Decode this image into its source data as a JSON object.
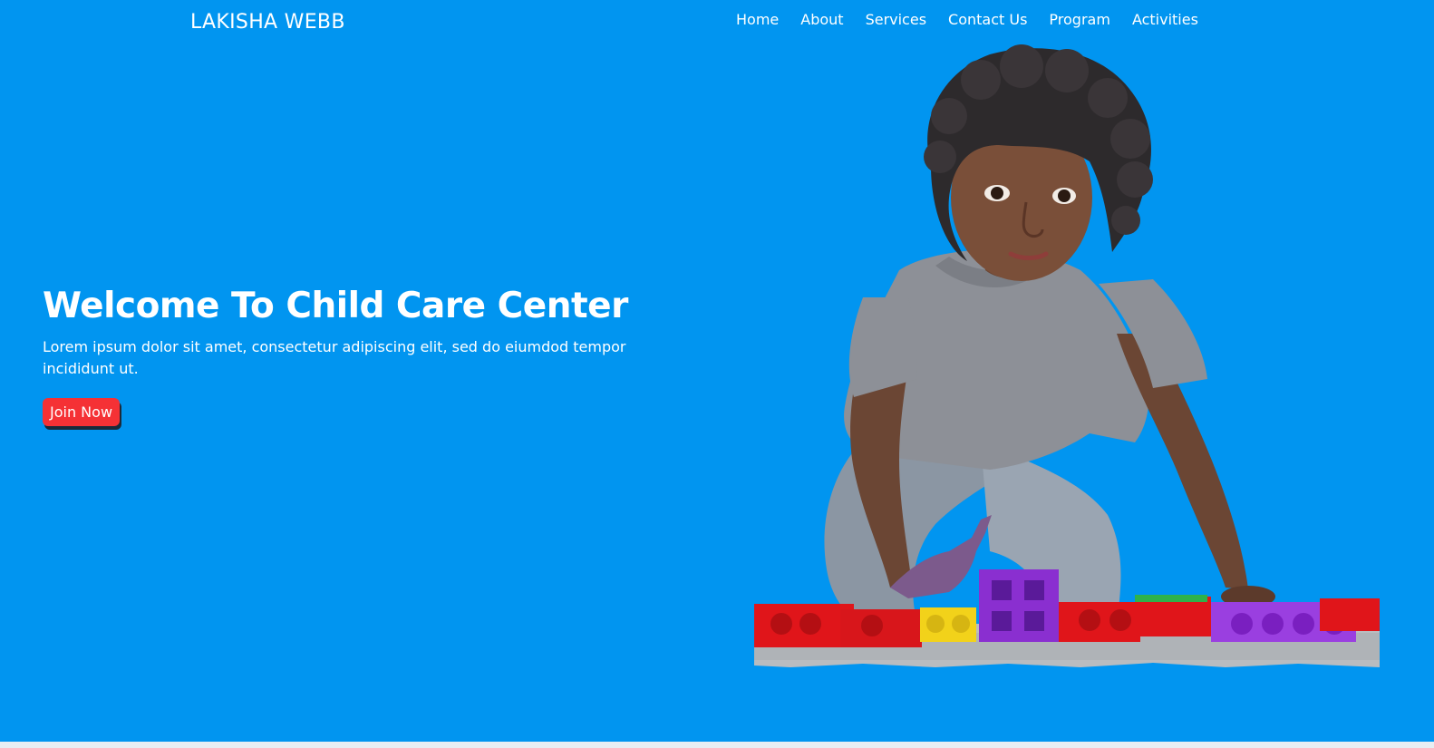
{
  "brand": {
    "name": "LAKISHA WEBB"
  },
  "nav": {
    "items": [
      {
        "label": "Home"
      },
      {
        "label": "About"
      },
      {
        "label": "Services"
      },
      {
        "label": "Contact Us"
      },
      {
        "label": "Program"
      },
      {
        "label": "Activities"
      }
    ]
  },
  "hero": {
    "title": "Welcome To Child Care Center",
    "subtitle": "Lorem ipsum dolor sit amet, consectetur adipiscing elit, sed do eiumdod tempor incididunt ut.",
    "cta_label": "Join Now"
  },
  "colors": {
    "background": "#0195f0",
    "cta": "#f53135",
    "text": "#ffffff"
  },
  "image": {
    "subject": "child-playing-with-blocks"
  }
}
